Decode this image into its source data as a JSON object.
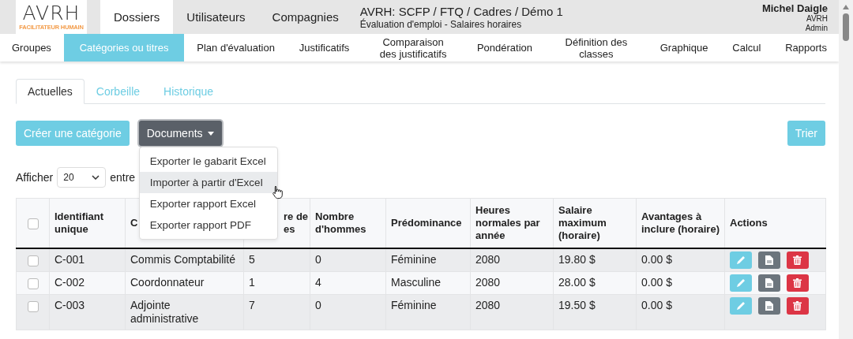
{
  "logo": {
    "text": "AVRH",
    "tagline": "FACILITATEUR HUMAIN"
  },
  "main_nav": [
    {
      "label": "Dossiers",
      "selected": true
    },
    {
      "label": "Utilisateurs",
      "selected": false
    },
    {
      "label": "Compagnies",
      "selected": false
    }
  ],
  "context": {
    "title": "AVRH: SCFP / FTQ / Cadres / Démo 1",
    "subtitle": "Évaluation d'emploi - Salaires horaires"
  },
  "user": {
    "name": "Michel Daigle",
    "company": "AVRH",
    "role": "Admin"
  },
  "sub_nav": [
    {
      "label": "Groupes",
      "selected": false
    },
    {
      "label": "Catégories ou titres",
      "selected": true
    },
    {
      "label": "Plan d'évaluation",
      "selected": false
    },
    {
      "label": "Justificatifs",
      "selected": false
    },
    {
      "label": "Comparaison des justificatifs",
      "selected": false
    },
    {
      "label": "Pondération",
      "selected": false
    },
    {
      "label": "Définition des classes",
      "selected": false
    },
    {
      "label": "Graphique",
      "selected": false
    },
    {
      "label": "Calcul",
      "selected": false
    },
    {
      "label": "Rapports",
      "selected": false
    }
  ],
  "tabs": [
    {
      "label": "Actuelles",
      "selected": true
    },
    {
      "label": "Corbeille",
      "selected": false
    },
    {
      "label": "Historique",
      "selected": false
    }
  ],
  "buttons": {
    "create": "Créer une catégorie",
    "documents": "Documents",
    "sort": "Trier"
  },
  "documents_menu": {
    "open": true,
    "items": [
      {
        "label": "Exporter le gabarit Excel",
        "hovered": false
      },
      {
        "label": "Importer à partir d'Excel",
        "hovered": true
      },
      {
        "label": "Exporter rapport Excel",
        "hovered": false
      },
      {
        "label": "Exporter rapport PDF",
        "hovered": false
      }
    ]
  },
  "page_length": {
    "label": "Afficher",
    "value": "20",
    "suffix": "entre"
  },
  "table": {
    "select_all_checked": false,
    "columns": [
      "Identifiant unique",
      "C",
      "re de es",
      "Nombre d'hommes",
      "Prédominance",
      "Heures normales par année",
      "Salaire maximum (horaire)",
      "Avantages à inclure (horaire)",
      "Actions"
    ],
    "rows": [
      {
        "checked": false,
        "cells": [
          "C-001",
          "Commis Comptabilité",
          "5",
          "0",
          "Féminine",
          "2080",
          "19.80 $",
          "0.00 $"
        ]
      },
      {
        "checked": false,
        "cells": [
          "C-002",
          "Coordonnateur",
          "1",
          "4",
          "Masculine",
          "2080",
          "28.00 $",
          "0.00 $"
        ]
      },
      {
        "checked": false,
        "cells": [
          "C-003",
          "Adjointe administrative",
          "7",
          "0",
          "Féminine",
          "2080",
          "19.50 $",
          "0.00 $"
        ]
      }
    ]
  }
}
